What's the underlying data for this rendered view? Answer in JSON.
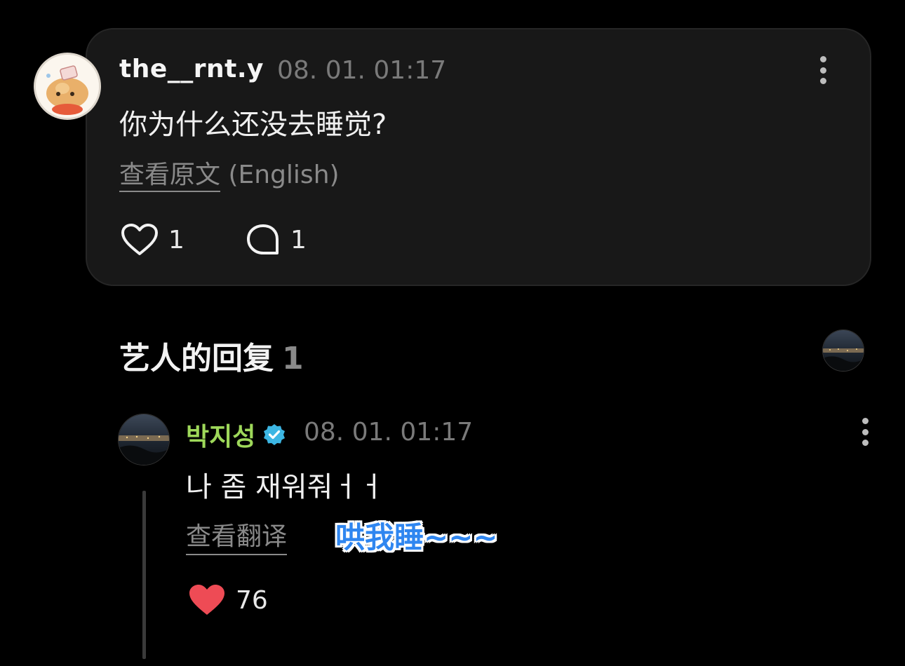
{
  "comment": {
    "username": "the__rnt.y",
    "timestamp": "08. 01. 01:17",
    "text": "你为什么还没去睡觉?",
    "view_original_label": "查看原文",
    "original_language": "(English)",
    "like_count": "1",
    "reply_count": "1"
  },
  "artist_replies": {
    "title": "艺人的回复",
    "count": "1"
  },
  "reply": {
    "artist_name": "박지성",
    "timestamp": "08. 01. 01:17",
    "text": "나 좀 재워줘ㅓㅓ",
    "view_translation_label": "查看翻译",
    "overlay_caption": "哄我睡~~~",
    "like_count": "76",
    "name_color": "#9ed85a",
    "verified_color": "#3cb6e3",
    "like_color": "#ee4b55"
  },
  "icons": {
    "more": "more-vertical-icon",
    "like": "heart-icon",
    "reply": "comment-bubble-icon",
    "verified": "verified-badge-icon"
  }
}
